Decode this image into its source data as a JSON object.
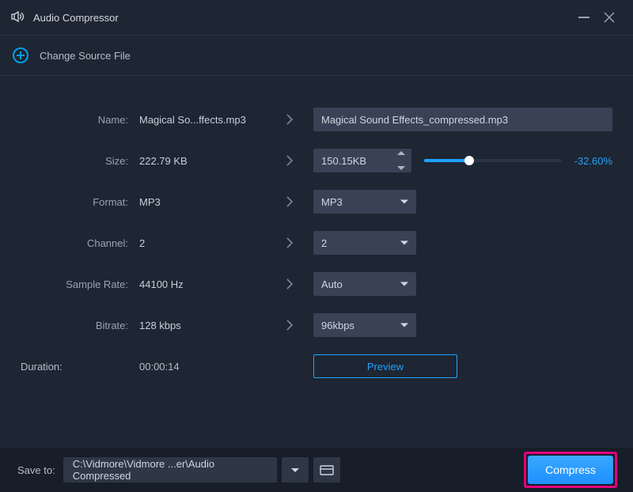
{
  "titlebar": {
    "app_title": "Audio Compressor"
  },
  "sourcebar": {
    "change_source": "Change Source File"
  },
  "labels": {
    "name": "Name:",
    "size": "Size:",
    "format": "Format:",
    "channel": "Channel:",
    "sample_rate": "Sample Rate:",
    "bitrate": "Bitrate:",
    "duration": "Duration:"
  },
  "original": {
    "name": "Magical So...ffects.mp3",
    "size": "222.79 KB",
    "format": "MP3",
    "channel": "2",
    "sample_rate": "44100 Hz",
    "bitrate": "128 kbps",
    "duration": "00:00:14"
  },
  "output": {
    "name": "Magical Sound Effects_compressed.mp3",
    "size": "150.15KB",
    "size_percent": "-32.60%",
    "format": "MP3",
    "channel": "2",
    "sample_rate": "Auto",
    "bitrate": "96kbps"
  },
  "actions": {
    "preview": "Preview",
    "compress": "Compress"
  },
  "footer": {
    "save_to_label": "Save to:",
    "save_path": "C:\\Vidmore\\Vidmore ...er\\Audio Compressed"
  }
}
